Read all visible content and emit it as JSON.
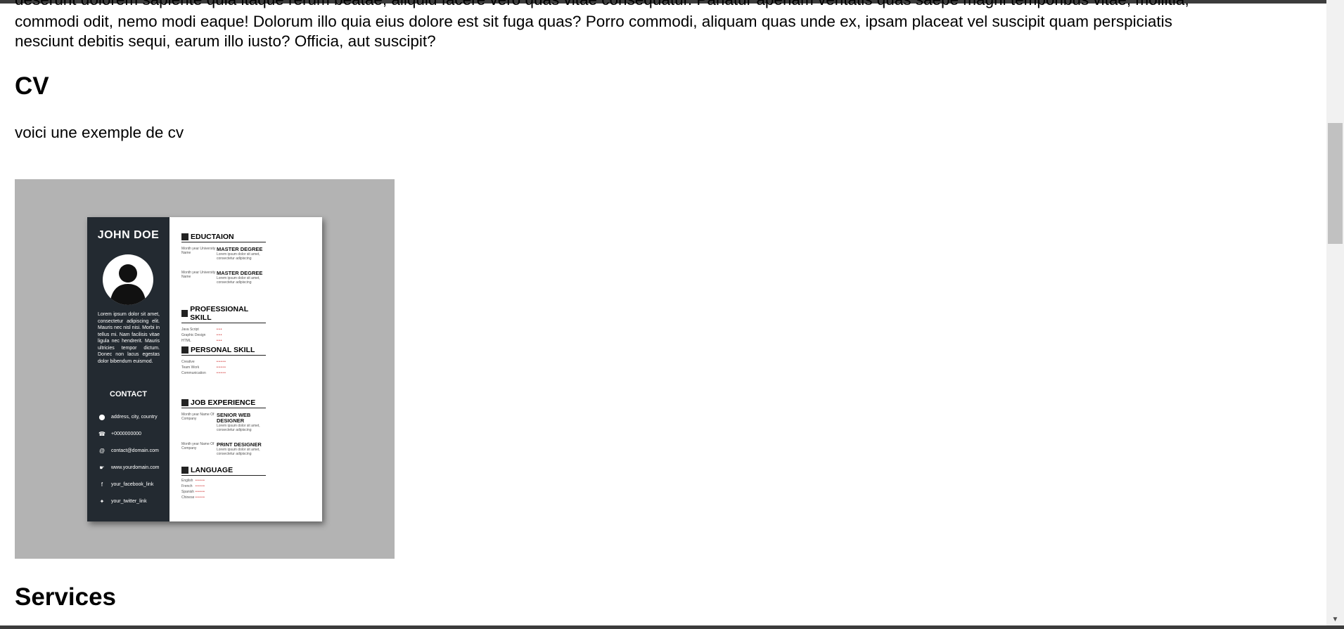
{
  "page": {
    "text_line_1": "deserunt dolorem sapiente quia itaque rerum beatae, aliquid facere vero quas vitae consequatur. Pariatur aperiam veritatis quas saepe magni temporibus vitae, mollitia,",
    "text_line_2": "commodi odit, nemo modi eaque! Dolorum illo quia eius dolore est sit fuga quas? Porro commodi, aliquam quas unde ex, ipsam placeat vel suscipit quam perspiciatis",
    "text_line_3": "nesciunt debitis sequi, earum illo iusto? Officia, aut suscipit?",
    "cv_heading": "CV",
    "cv_intro": "voici une exemple de cv",
    "services_heading": "Services"
  },
  "cv_image": {
    "name": "JOHN DOE",
    "bio": "Lorem ipsum dolor sit amet, consectetur adipiscing elit. Mauris nec nisl nisi. Morbi in tellus mi. Nam facilisis vitae ligula nec hendrerit. Mauris ultricies tempor dictum. Donec non lacus egestas dolor bibendum euismod.",
    "contact_title": "CONTACT",
    "contact": [
      {
        "icon": "location-icon",
        "glyph": "⬤",
        "text": "address, city, country"
      },
      {
        "icon": "phone-icon",
        "glyph": "☎",
        "text": "+0000000000"
      },
      {
        "icon": "email-icon",
        "glyph": "@",
        "text": "contact@domain.com"
      },
      {
        "icon": "web-icon",
        "glyph": "☛",
        "text": "www.yourdomain.com"
      },
      {
        "icon": "facebook-icon",
        "glyph": "f",
        "text": "your_facebook_link"
      },
      {
        "icon": "twitter-icon",
        "glyph": "✦",
        "text": "your_twitter_link"
      }
    ],
    "education_title": "EDUCTAION",
    "education": [
      {
        "when": "Month year University Name",
        "title": "MASTER DEGREE",
        "desc": "Lorem ipsum dolor sit amet, consectetur adipiscing"
      },
      {
        "when": "Month year University Name",
        "title": "MASTER DEGREE",
        "desc": "Lorem ipsum dolor sit amet, consectetur adipiscing"
      }
    ],
    "professional_title": "PROFESSIONAL SKILL",
    "professional": [
      {
        "name": "Java Script",
        "dots": "•••"
      },
      {
        "name": "Graphic Design",
        "dots": "•••"
      },
      {
        "name": "HTML",
        "dots": "•••"
      }
    ],
    "personal_title": "PERSONAL SKILL",
    "personal": [
      {
        "name": "Creative",
        "dots": "•••••"
      },
      {
        "name": "Team Work",
        "dots": "•••••"
      },
      {
        "name": "Communication",
        "dots": "•••••"
      }
    ],
    "job_title": "JOB EXPERIENCE",
    "jobs": [
      {
        "when": "Month year Name Of Company",
        "title": "SENIOR WEB DESIGNER",
        "desc": "Lorem ipsum dolor sit amet, consectetur adipiscing"
      },
      {
        "when": "Month year Name Of Company",
        "title": "PRINT DESIGNER",
        "desc": "Lorem ipsum dolor sit amet, consectetur adipiscing"
      }
    ],
    "language_title": "LANGUAGE",
    "languages": [
      {
        "name": "English",
        "dots": "•••••"
      },
      {
        "name": "French",
        "dots": "•••••"
      },
      {
        "name": "Spanish",
        "dots": "•••••"
      },
      {
        "name": "Chinese",
        "dots": "•••••"
      }
    ]
  },
  "colors": {
    "sidebar": "#232a31",
    "frame": "#b3b3b3",
    "accent_dots": "#cc2222"
  }
}
